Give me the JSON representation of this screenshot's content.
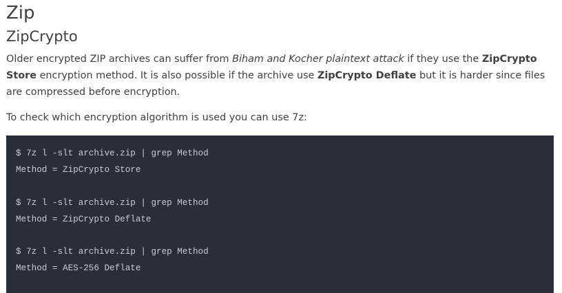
{
  "page": {
    "title": "Zip",
    "section_title": "ZipCrypto"
  },
  "intro": {
    "t1": "Older encrypted ZIP archives can suffer from ",
    "attack": "Biham and Kocher plaintext attack",
    "t2": " if they use the ",
    "store": "ZipCrypto Store",
    "t3": " encryption method. It is also possible if the archive use ",
    "deflate": "ZipCrypto Deflate",
    "t4": " but it is harder since files are compressed before encryption."
  },
  "check_text": "To check which encryption algorithm is used you can use 7z:",
  "code": {
    "blocks": [
      {
        "command": "$ 7z l -slt archive.zip | grep Method",
        "output": "Method = ZipCrypto Store"
      },
      {
        "command": "$ 7z l -slt archive.zip | grep Method",
        "output": "Method = ZipCrypto Deflate"
      },
      {
        "command": "$ 7z l -slt archive.zip | grep Method",
        "output": "Method = AES-256 Deflate"
      }
    ]
  },
  "colors": {
    "text": "#404040",
    "code_background": "#2b2e38",
    "code_text": "#c9ccd4"
  }
}
